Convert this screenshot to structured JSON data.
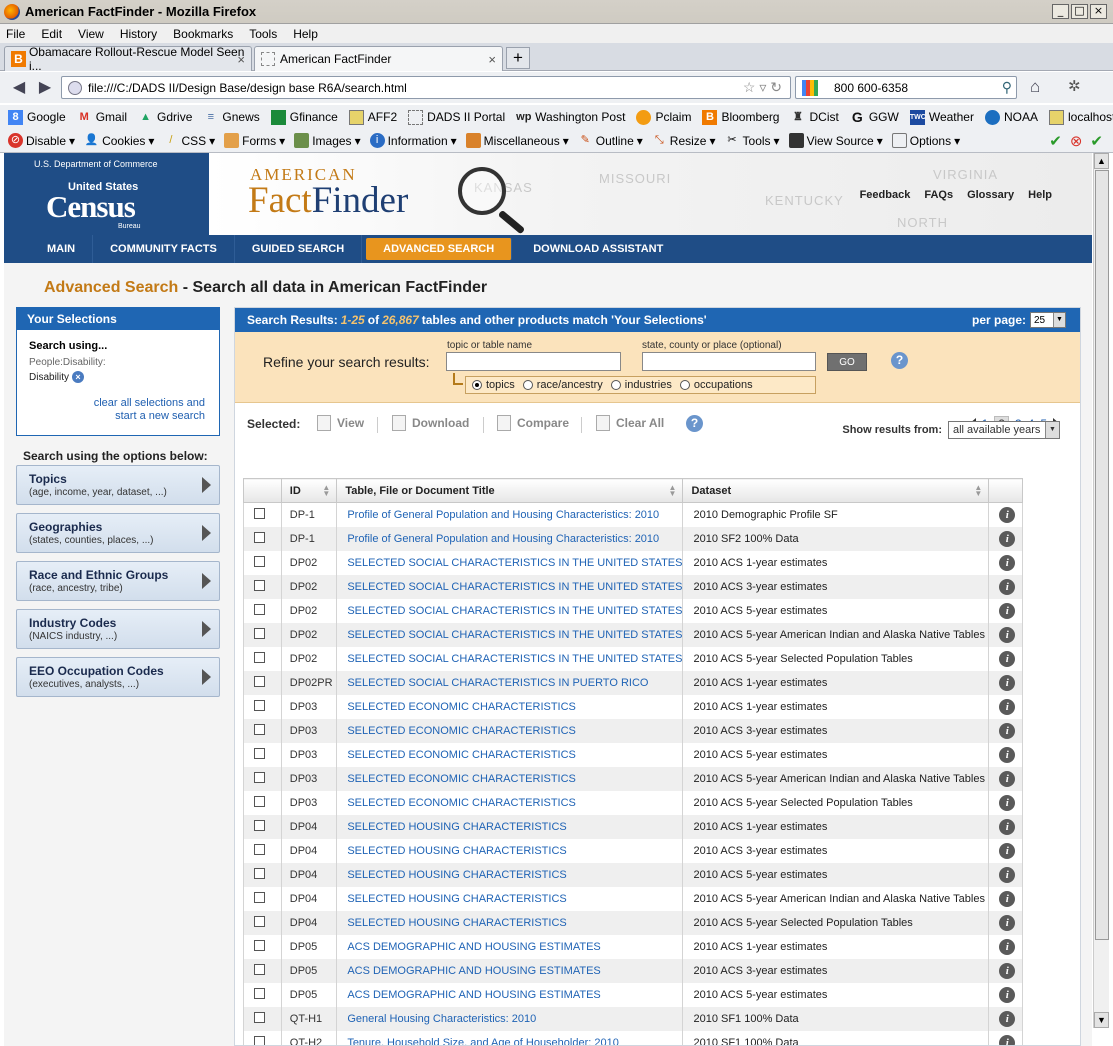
{
  "window": {
    "title": "American FactFinder - Mozilla Firefox"
  },
  "menu": [
    "File",
    "Edit",
    "View",
    "History",
    "Bookmarks",
    "Tools",
    "Help"
  ],
  "tabs": [
    {
      "label": "Obamacare Rollout-Rescue Model Seen i...",
      "active": false
    },
    {
      "label": "American FactFinder",
      "active": true
    }
  ],
  "address": {
    "url": "file:///C:/DADS II/Design Base/design base R6A/search.html"
  },
  "search": {
    "value": "800 600-6358"
  },
  "bookmarks": [
    {
      "label": "Google",
      "icon": "google-icon",
      "color": "#4285f4"
    },
    {
      "label": "Gmail",
      "icon": "gmail-icon",
      "color": "#d93025"
    },
    {
      "label": "Gdrive",
      "icon": "gdrive-icon",
      "color": "#1fa463"
    },
    {
      "label": "Gnews",
      "icon": "gnews-icon",
      "color": "#4a6fa5"
    },
    {
      "label": "Gfinance",
      "icon": "gfinance-icon",
      "color": "#1b8a3a"
    },
    {
      "label": "AFF2",
      "icon": "folder-icon",
      "color": "#e6d36a"
    },
    {
      "label": "DADS II Portal",
      "icon": "page-icon",
      "color": "#ffffff"
    },
    {
      "label": "Washington Post",
      "icon": "wapo-icon",
      "color": "#222222"
    },
    {
      "label": "Pclaim",
      "icon": "pclaim-icon",
      "color": "#f39c12"
    },
    {
      "label": "Bloomberg",
      "icon": "bloomberg-icon",
      "color": "#f07a00"
    },
    {
      "label": "DCist",
      "icon": "dcist-icon",
      "color": "#333333"
    },
    {
      "label": "GGW",
      "icon": "ggw-icon",
      "color": "#111111"
    },
    {
      "label": "Weather",
      "icon": "twc-icon",
      "color": "#1c4aa0"
    },
    {
      "label": "NOAA",
      "icon": "noaa-icon",
      "color": "#1c6ec0"
    },
    {
      "label": "localhost",
      "icon": "folder-icon",
      "color": "#e6d36a"
    }
  ],
  "devtools": [
    "Disable",
    "Cookies",
    "CSS",
    "Forms",
    "Images",
    "Information",
    "Miscellaneous",
    "Outline",
    "Resize",
    "Tools",
    "View Source",
    "Options"
  ],
  "header": {
    "dept": "U.S. Department of Commerce",
    "united_states": "United States",
    "census": "Census",
    "bureau": "Bureau",
    "brand_american": "AMERICAN",
    "brand_fact": "Fact",
    "brand_finder": "Finder",
    "map_labels": [
      "MISSOURI",
      "KANSAS",
      "KENTUCKY",
      "VIRGINIA",
      "NORTH"
    ],
    "links": [
      "Feedback",
      "FAQs",
      "Glossary",
      "Help"
    ]
  },
  "nav": [
    "MAIN",
    "COMMUNITY FACTS",
    "GUIDED SEARCH",
    "ADVANCED SEARCH",
    "DOWNLOAD ASSISTANT"
  ],
  "nav_active": "ADVANCED SEARCH",
  "page": {
    "heading_accent": "Advanced Search",
    "heading_rest": " - Search all data in American FactFinder"
  },
  "your_selections": {
    "title": "Your Selections",
    "using": "Search using...",
    "category": "People:Disability:",
    "value": "Disability",
    "clear_line1": "clear all selections and",
    "clear_line2": "start a new search"
  },
  "search_options": {
    "label": "Search using the options below:",
    "items": [
      {
        "title": "Topics",
        "sub": "(age, income, year, dataset, ...)"
      },
      {
        "title": "Geographies",
        "sub": "(states, counties, places, ...)"
      },
      {
        "title": "Race and Ethnic Groups",
        "sub": "(race, ancestry, tribe)"
      },
      {
        "title": "Industry Codes",
        "sub": "(NAICS industry, ...)"
      },
      {
        "title": "EEO Occupation Codes",
        "sub": "(executives, analysts, ...)"
      }
    ]
  },
  "results": {
    "prefix": "Search Results:",
    "range": "1-25",
    "of": "of",
    "total": "26,867",
    "suffix": "tables and other products match 'Your Selections'",
    "per_page_label": "per page:",
    "per_page": "25",
    "refine_label": "Refine your search results:",
    "field1_label": "topic or table name",
    "field2_label": "state, county or place (optional)",
    "go": "GO",
    "radios": [
      {
        "label": "topics",
        "checked": true
      },
      {
        "label": "race/ancestry",
        "checked": false
      },
      {
        "label": "industries",
        "checked": false
      },
      {
        "label": "occupations",
        "checked": false
      }
    ],
    "selected_label": "Selected:",
    "actions": [
      "View",
      "Download",
      "Compare",
      "Clear All"
    ],
    "pages": [
      "1",
      "2",
      "3",
      "4",
      "5"
    ],
    "current_page": "2",
    "show_from_label": "Show results from:",
    "show_from": "all available years",
    "columns": [
      "ID",
      "Table, File or Document Title",
      "Dataset"
    ],
    "rows": [
      {
        "id": "DP-1",
        "title": "Profile of General Population and Housing Characteristics: 2010",
        "dataset": "2010 Demographic Profile SF"
      },
      {
        "id": "DP-1",
        "title": "Profile of General Population and Housing Characteristics: 2010",
        "dataset": "2010 SF2 100% Data"
      },
      {
        "id": "DP02",
        "title": "SELECTED SOCIAL CHARACTERISTICS IN THE UNITED STATES",
        "dataset": "2010 ACS 1-year estimates"
      },
      {
        "id": "DP02",
        "title": "SELECTED SOCIAL CHARACTERISTICS IN THE UNITED STATES",
        "dataset": "2010 ACS 3-year estimates"
      },
      {
        "id": "DP02",
        "title": "SELECTED SOCIAL CHARACTERISTICS IN THE UNITED STATES",
        "dataset": "2010 ACS 5-year estimates"
      },
      {
        "id": "DP02",
        "title": "SELECTED SOCIAL CHARACTERISTICS IN THE UNITED STATES",
        "dataset": "2010 ACS 5-year American Indian and Alaska Native Tables"
      },
      {
        "id": "DP02",
        "title": "SELECTED SOCIAL CHARACTERISTICS IN THE UNITED STATES",
        "dataset": "2010 ACS 5-year Selected Population Tables"
      },
      {
        "id": "DP02PR",
        "title": "SELECTED SOCIAL CHARACTERISTICS IN PUERTO RICO",
        "dataset": "2010 ACS 1-year estimates"
      },
      {
        "id": "DP03",
        "title": "SELECTED ECONOMIC CHARACTERISTICS",
        "dataset": "2010 ACS 1-year estimates"
      },
      {
        "id": "DP03",
        "title": "SELECTED ECONOMIC CHARACTERISTICS",
        "dataset": "2010 ACS 3-year estimates"
      },
      {
        "id": "DP03",
        "title": "SELECTED ECONOMIC CHARACTERISTICS",
        "dataset": "2010 ACS 5-year estimates"
      },
      {
        "id": "DP03",
        "title": "SELECTED ECONOMIC CHARACTERISTICS",
        "dataset": "2010 ACS 5-year American Indian and Alaska Native Tables"
      },
      {
        "id": "DP03",
        "title": "SELECTED ECONOMIC CHARACTERISTICS",
        "dataset": "2010 ACS 5-year Selected Population Tables"
      },
      {
        "id": "DP04",
        "title": "SELECTED HOUSING CHARACTERISTICS",
        "dataset": "2010 ACS 1-year estimates"
      },
      {
        "id": "DP04",
        "title": "SELECTED HOUSING CHARACTERISTICS",
        "dataset": "2010 ACS 3-year estimates"
      },
      {
        "id": "DP04",
        "title": "SELECTED HOUSING CHARACTERISTICS",
        "dataset": "2010 ACS 5-year estimates"
      },
      {
        "id": "DP04",
        "title": "SELECTED HOUSING CHARACTERISTICS",
        "dataset": "2010 ACS 5-year American Indian and Alaska Native Tables"
      },
      {
        "id": "DP04",
        "title": "SELECTED HOUSING CHARACTERISTICS",
        "dataset": "2010 ACS 5-year Selected Population Tables"
      },
      {
        "id": "DP05",
        "title": "ACS DEMOGRAPHIC AND HOUSING ESTIMATES",
        "dataset": "2010 ACS 1-year estimates"
      },
      {
        "id": "DP05",
        "title": "ACS DEMOGRAPHIC AND HOUSING ESTIMATES",
        "dataset": "2010 ACS 3-year estimates"
      },
      {
        "id": "DP05",
        "title": "ACS DEMOGRAPHIC AND HOUSING ESTIMATES",
        "dataset": "2010 ACS 5-year estimates"
      },
      {
        "id": "QT-H1",
        "title": "General Housing Characteristics: 2010",
        "dataset": "2010 SF1 100% Data"
      },
      {
        "id": "QT-H2",
        "title": "Tenure, Household Size, and Age of Householder: 2010",
        "dataset": "2010 SF1 100% Data"
      }
    ]
  },
  "colors": {
    "census_blue": "#1f4d86",
    "panel_blue": "#1f66b3",
    "accent_orange": "#c37a16",
    "nav_active": "#e8951e",
    "link_blue": "#1f63b5",
    "refine_bg": "#fbe3bc"
  }
}
